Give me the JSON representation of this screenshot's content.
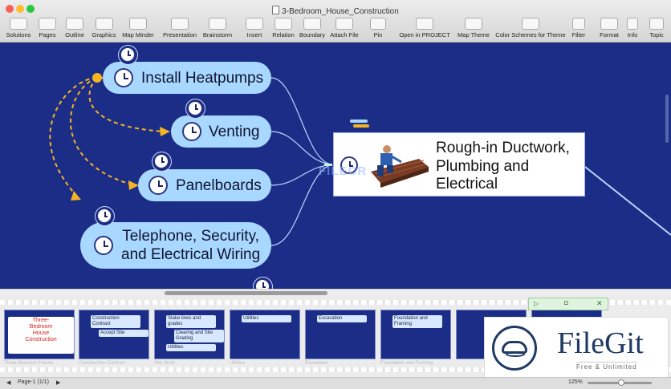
{
  "window": {
    "title": "3-Bedroom_House_Construction",
    "traffic_lights": [
      "#fc5f57",
      "#fdbc2e",
      "#28c840"
    ]
  },
  "toolbar": [
    {
      "label": "Solutions",
      "icon": "solutions-icon"
    },
    {
      "label": "Pages",
      "icon": "pages-icon"
    },
    {
      "label": "Outline",
      "icon": "outline-icon"
    },
    {
      "label": "Graphics",
      "icon": "graphics-icon"
    },
    {
      "label": "Map Minder",
      "icon": "map-minder-icon"
    },
    {
      "label": "Presentation",
      "icon": "presentation-icon"
    },
    {
      "label": "Brainstorm",
      "icon": "brainstorm-icon"
    },
    {
      "label": "Insert",
      "icon": "insert-icon"
    },
    {
      "label": "Relation",
      "icon": "relation-icon"
    },
    {
      "label": "Boundary",
      "icon": "boundary-icon"
    },
    {
      "label": "Attach File",
      "icon": "attach-file-icon"
    },
    {
      "label": "Pin",
      "icon": "pin-icon"
    },
    {
      "label": "Open in PROJECT",
      "icon": "open-in-project-icon"
    },
    {
      "label": "Map Theme",
      "icon": "map-theme-icon"
    },
    {
      "label": "Color Schemes for Theme",
      "icon": "color-schemes-icon"
    },
    {
      "label": "Filter",
      "icon": "filter-icon"
    },
    {
      "label": "Format",
      "icon": "format-icon"
    },
    {
      "label": "Info",
      "icon": "info-icon"
    },
    {
      "label": "Topic",
      "icon": "topic-icon"
    }
  ],
  "canvas": {
    "background": "#1b2d86",
    "topic_fill": "#a8d7ff",
    "relation_color": "#f5b324",
    "main_topic": {
      "label_lines": [
        "Rough-in Ductwork,",
        "Plumbing and",
        "Electrical"
      ]
    },
    "subtopics": [
      {
        "label_lines": [
          "Install Heatpumps"
        ]
      },
      {
        "label_lines": [
          "Venting"
        ]
      },
      {
        "label_lines": [
          "Panelboards"
        ]
      },
      {
        "label_lines": [
          "Telephone, Security,",
          "and Electrical Wiring"
        ]
      }
    ]
  },
  "filmstrip": {
    "slides": [
      {
        "title_lines": [
          "Three-",
          "Bedroom",
          "House",
          "Construction"
        ],
        "caption": "Three-Bedroom House..."
      },
      {
        "cards": [
          "Construction Contract",
          "Accept Site"
        ],
        "caption": "Construction Contract"
      },
      {
        "cards": [
          "Stake lines and grades",
          "Clearing and Site Grading",
          "Utilities"
        ],
        "caption": "Site Work"
      },
      {
        "cards": [
          "Utilities"
        ],
        "caption": "Utilities"
      },
      {
        "cards": [
          "Excavation"
        ],
        "caption": "Excavation"
      },
      {
        "cards": [
          "Foundation and Framing"
        ],
        "caption": "Foundation and Framing"
      },
      {
        "cards": [],
        "caption": ""
      },
      {
        "cards": [],
        "caption": ""
      }
    ]
  },
  "watermark": {
    "brand": "FileGit",
    "tagline": "Free & Unlimited",
    "overlay": "FILECR"
  },
  "status": {
    "page": "Page-1 (1/1)",
    "zoom": "125%"
  }
}
